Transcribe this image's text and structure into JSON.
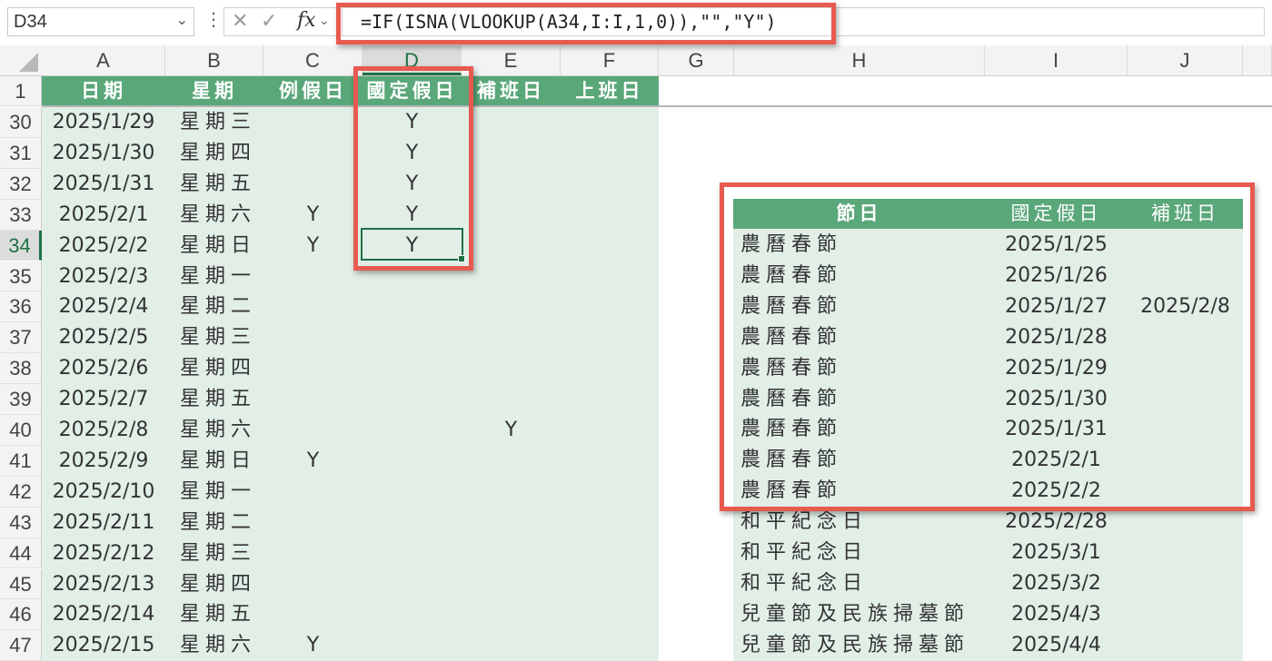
{
  "formula_bar": {
    "name_box": "D34",
    "cancel_icon": "✕",
    "enter_icon": "✓",
    "fx_label": "fx",
    "formula": "=IF(ISNA(VLOOKUP(A34,I:I,1,0)),\"\",\"Y\")"
  },
  "columns": [
    "A",
    "B",
    "C",
    "D",
    "E",
    "F",
    "G",
    "H",
    "I",
    "J"
  ],
  "selected_column": "D",
  "header_row_number": "1",
  "table_headers": {
    "date": "日期",
    "weekday": "星期",
    "weekend": "例假日",
    "holiday": "國定假日",
    "makeup": "補班日",
    "workday": "上班日"
  },
  "rows": [
    {
      "n": "30",
      "date": "2025/1/29",
      "weekday": "星期三",
      "c": "",
      "d": "Y",
      "e": ""
    },
    {
      "n": "31",
      "date": "2025/1/30",
      "weekday": "星期四",
      "c": "",
      "d": "Y",
      "e": ""
    },
    {
      "n": "32",
      "date": "2025/1/31",
      "weekday": "星期五",
      "c": "",
      "d": "Y",
      "e": ""
    },
    {
      "n": "33",
      "date": "2025/2/1",
      "weekday": "星期六",
      "c": "Y",
      "d": "Y",
      "e": ""
    },
    {
      "n": "34",
      "date": "2025/2/2",
      "weekday": "星期日",
      "c": "Y",
      "d": "Y",
      "e": ""
    },
    {
      "n": "35",
      "date": "2025/2/3",
      "weekday": "星期一",
      "c": "",
      "d": "",
      "e": ""
    },
    {
      "n": "36",
      "date": "2025/2/4",
      "weekday": "星期二",
      "c": "",
      "d": "",
      "e": ""
    },
    {
      "n": "37",
      "date": "2025/2/5",
      "weekday": "星期三",
      "c": "",
      "d": "",
      "e": ""
    },
    {
      "n": "38",
      "date": "2025/2/6",
      "weekday": "星期四",
      "c": "",
      "d": "",
      "e": ""
    },
    {
      "n": "39",
      "date": "2025/2/7",
      "weekday": "星期五",
      "c": "",
      "d": "",
      "e": ""
    },
    {
      "n": "40",
      "date": "2025/2/8",
      "weekday": "星期六",
      "c": "",
      "d": "",
      "e": "Y"
    },
    {
      "n": "41",
      "date": "2025/2/9",
      "weekday": "星期日",
      "c": "Y",
      "d": "",
      "e": ""
    },
    {
      "n": "42",
      "date": "2025/2/10",
      "weekday": "星期一",
      "c": "",
      "d": "",
      "e": ""
    },
    {
      "n": "43",
      "date": "2025/2/11",
      "weekday": "星期二",
      "c": "",
      "d": "",
      "e": ""
    },
    {
      "n": "44",
      "date": "2025/2/12",
      "weekday": "星期三",
      "c": "",
      "d": "",
      "e": ""
    },
    {
      "n": "45",
      "date": "2025/2/13",
      "weekday": "星期四",
      "c": "",
      "d": "",
      "e": ""
    },
    {
      "n": "46",
      "date": "2025/2/14",
      "weekday": "星期五",
      "c": "",
      "d": "",
      "e": ""
    },
    {
      "n": "47",
      "date": "2025/2/15",
      "weekday": "星期六",
      "c": "Y",
      "d": "",
      "e": ""
    }
  ],
  "holiday_table": {
    "headers": {
      "name": "節日",
      "holiday": "國定假日",
      "makeup": "補班日"
    },
    "rows": [
      {
        "name": "農曆春節",
        "date": "2025/1/25",
        "makeup": ""
      },
      {
        "name": "農曆春節",
        "date": "2025/1/26",
        "makeup": ""
      },
      {
        "name": "農曆春節",
        "date": "2025/1/27",
        "makeup": "2025/2/8"
      },
      {
        "name": "農曆春節",
        "date": "2025/1/28",
        "makeup": ""
      },
      {
        "name": "農曆春節",
        "date": "2025/1/29",
        "makeup": ""
      },
      {
        "name": "農曆春節",
        "date": "2025/1/30",
        "makeup": ""
      },
      {
        "name": "農曆春節",
        "date": "2025/1/31",
        "makeup": ""
      },
      {
        "name": "農曆春節",
        "date": "2025/2/1",
        "makeup": ""
      },
      {
        "name": "農曆春節",
        "date": "2025/2/2",
        "makeup": ""
      },
      {
        "name": "和平紀念日",
        "date": "2025/2/28",
        "makeup": ""
      },
      {
        "name": "和平紀念日",
        "date": "2025/3/1",
        "makeup": ""
      },
      {
        "name": "和平紀念日",
        "date": "2025/3/2",
        "makeup": ""
      },
      {
        "name": "兒童節及民族掃墓節",
        "date": "2025/4/3",
        "makeup": ""
      },
      {
        "name": "兒童節及民族掃墓節",
        "date": "2025/4/4",
        "makeup": ""
      }
    ]
  },
  "colors": {
    "header_green": "#5aa77a",
    "body_green": "#e1efe7",
    "highlight_red": "#e85a4f",
    "selection_green": "#1e7145"
  }
}
